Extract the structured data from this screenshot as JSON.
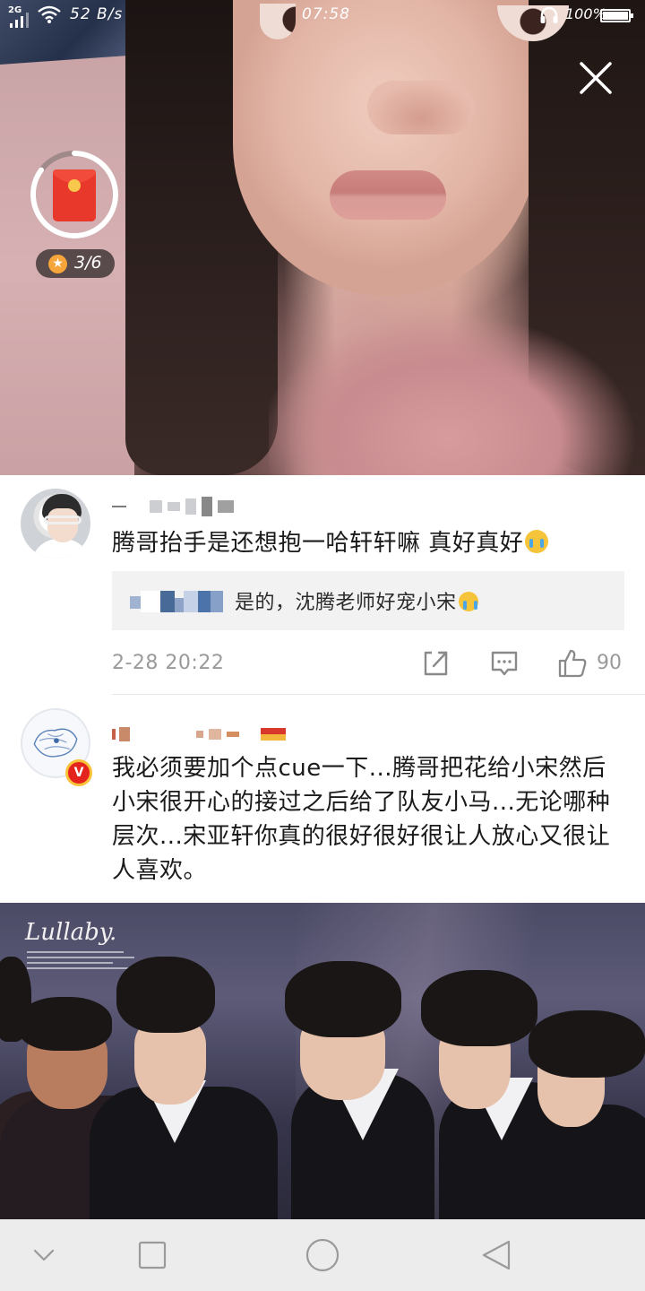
{
  "status_bar": {
    "network": "2G",
    "speed": "52 B/s",
    "time": "07:58",
    "battery": "100%",
    "icons": [
      "signal-icon",
      "wifi-icon",
      "headphones-icon",
      "battery-icon"
    ]
  },
  "overlay": {
    "red_packet_progress": "3/6",
    "red_packet_progress_fraction": 0.85,
    "icons": [
      "close-icon",
      "red-packet-icon",
      "star-icon"
    ]
  },
  "comments": [
    {
      "text": "腾哥抬手是还想抱一哈轩轩嘛 真好真好",
      "reply": {
        "text": "是的，沈腾老师好宠小宋"
      },
      "time": "2-28 20:22",
      "like_count": "90",
      "icons": [
        "crying-emoji-icon",
        "share-icon",
        "comment-icon",
        "thumbs-up-icon"
      ]
    },
    {
      "text": "我必须要加个点cue一下...腾哥把花给小宋然后小宋很开心的接过之后给了队友小马...无论哪种层次...宋亚轩你真的很好很好很让人放心又很让人喜欢。",
      "icons": [
        "verified-badge-icon"
      ]
    }
  ],
  "image_caption": {
    "title": "Lullaby."
  },
  "nav_bar": {
    "icons": [
      "chevron-down-icon",
      "square-icon",
      "circle-icon",
      "triangle-back-icon"
    ]
  },
  "colors": {
    "red_packet": "#e8372b",
    "star": "#f5a53a",
    "verified": "#e5231d",
    "meta_text": "#9a9a9a",
    "reply_bg": "#f2f2f2"
  }
}
